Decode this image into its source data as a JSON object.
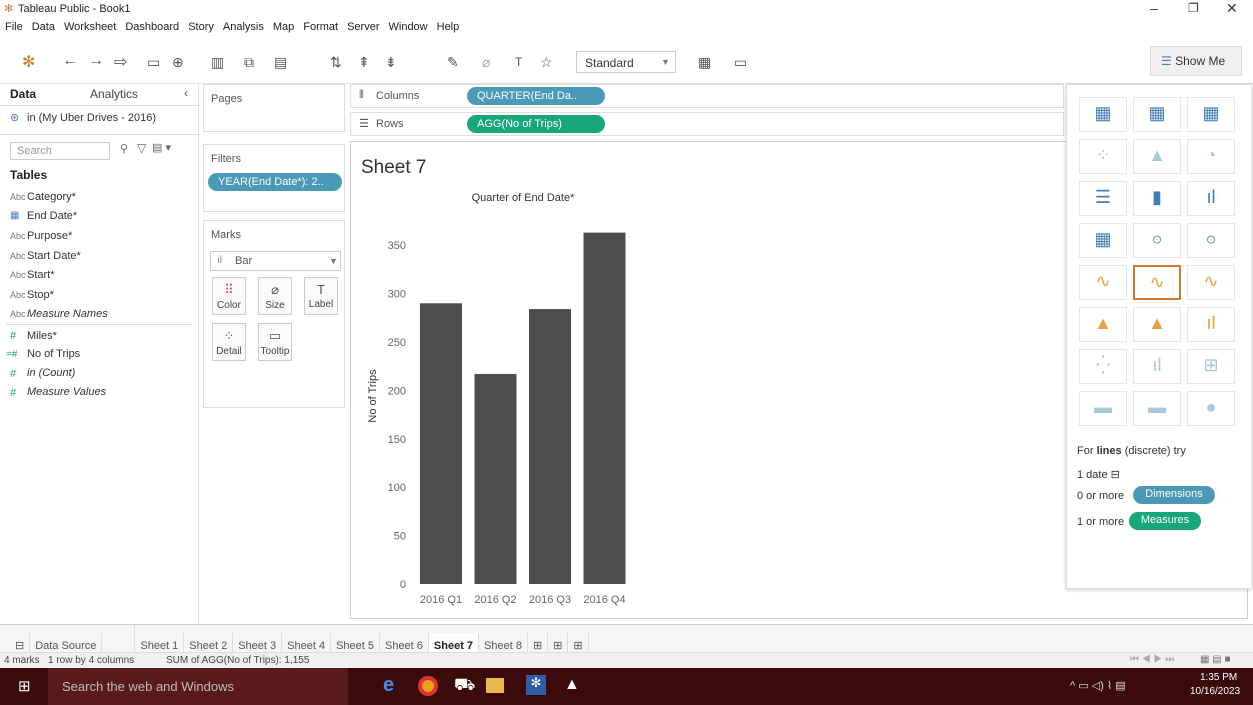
{
  "window": {
    "title": "Tableau Public - Book1"
  },
  "menu": [
    "File",
    "Data",
    "Worksheet",
    "Dashboard",
    "Story",
    "Analysis",
    "Map",
    "Format",
    "Server",
    "Window",
    "Help"
  ],
  "toolbar": {
    "fit_mode": "Standard",
    "show_me_label": "Show Me"
  },
  "data_pane": {
    "tab_data": "Data",
    "tab_analytics": "Analytics",
    "datasource": "in (My Uber Drives - 2016)",
    "search_placeholder": "Search",
    "tables_header": "Tables",
    "dimensions": [
      {
        "type": "Abc",
        "name": "Category*"
      },
      {
        "type": "date",
        "name": "End Date*"
      },
      {
        "type": "Abc",
        "name": "Purpose*"
      },
      {
        "type": "Abc",
        "name": "Start Date*"
      },
      {
        "type": "Abc",
        "name": "Start*"
      },
      {
        "type": "Abc",
        "name": "Stop*"
      },
      {
        "type": "Abc",
        "name": "Measure Names"
      }
    ],
    "measures": [
      {
        "type": "#",
        "name": "Miles*"
      },
      {
        "type": "=#",
        "name": "No of Trips"
      },
      {
        "type": "#",
        "name": "in (Count)"
      },
      {
        "type": "#",
        "name": "Measure Values"
      }
    ]
  },
  "shelves": {
    "pages": "Pages",
    "filters": "Filters",
    "filter_pill": "YEAR(End Date*): 2..",
    "marks": "Marks",
    "mark_type": "Bar",
    "mark_buttons": [
      "Color",
      "Size",
      "Label",
      "Detail",
      "Tooltip"
    ],
    "columns_label": "Columns",
    "rows_label": "Rows",
    "columns_pill": "QUARTER(End Da..",
    "rows_pill": "AGG(No of Trips)"
  },
  "sheet_title": "Sheet 7",
  "chart_data": {
    "type": "bar",
    "title": "Quarter of End Date*",
    "ylabel": "No of Trips",
    "categories": [
      "2016 Q1",
      "2016 Q2",
      "2016 Q3",
      "2016 Q4"
    ],
    "values": [
      290,
      217,
      284,
      363
    ],
    "ylim": [
      0,
      375
    ],
    "yticks": [
      0,
      50,
      100,
      150,
      200,
      250,
      300,
      350
    ],
    "grid": false,
    "color": "#4d4d4d"
  },
  "show_me": {
    "hint_prefix": "For ",
    "hint_bold": "lines",
    "hint_suffix": " (discrete) try",
    "req1": "1 date",
    "req2_prefix": "0 or more",
    "req2_pill": "Dimensions",
    "req3_prefix": "1 or more",
    "req3_pill": "Measures"
  },
  "tabs": {
    "data_source": "Data Source",
    "sheets": [
      "Sheet 1",
      "Sheet 2",
      "Sheet 3",
      "Sheet 4",
      "Sheet 5",
      "Sheet 6",
      "Sheet 7",
      "Sheet 8"
    ],
    "active": "Sheet 7"
  },
  "status": {
    "marks": "4 marks",
    "dims": "1 row by 4 columns",
    "sum": "SUM of AGG(No of Trips): 1,155"
  },
  "taskbar": {
    "search_placeholder": "Search the web and Windows",
    "time": "1:35 PM",
    "date": "10/16/2023"
  },
  "colors": {
    "pill_blue": "#4a9ab7",
    "pill_green": "#18a67a",
    "bar": "#4d4d4d",
    "taskbar": "#3b0b0b"
  }
}
